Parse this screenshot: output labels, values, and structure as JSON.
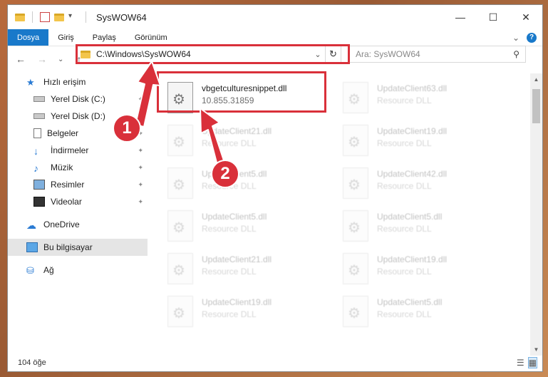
{
  "window": {
    "title": "SysWOW64",
    "controls": {
      "minimize": "—",
      "maximize": "☐",
      "close": "✕"
    }
  },
  "ribbon": {
    "tabs": [
      "Dosya",
      "Giriş",
      "Paylaş",
      "Görünüm"
    ],
    "expand": "⌄",
    "help": "?"
  },
  "nav": {
    "back": "←",
    "forward": "→",
    "recent": "⌄",
    "up": "↑",
    "address": "C:\\Windows\\SysWOW64",
    "address_chevron": "⌄",
    "refresh": "↻",
    "search_placeholder": "Ara: SysWOW64",
    "search_icon": "⚲"
  },
  "sidebar": {
    "items": [
      {
        "label": "Hızlı erişim",
        "icon": "star-icon"
      },
      {
        "label": "Yerel Disk (C:)",
        "icon": "drive-icon",
        "pinned": true
      },
      {
        "label": "Yerel Disk (D:)",
        "icon": "drive-icon",
        "pinned": true
      },
      {
        "label": "Belgeler",
        "icon": "document-icon",
        "pinned": true
      },
      {
        "label": "İndirmeler",
        "icon": "download-icon",
        "pinned": true
      },
      {
        "label": "Müzik",
        "icon": "music-icon",
        "pinned": true
      },
      {
        "label": "Resimler",
        "icon": "pictures-icon",
        "pinned": true
      },
      {
        "label": "Videolar",
        "icon": "videos-icon",
        "pinned": true
      },
      {
        "label": "OneDrive",
        "icon": "cloud-icon"
      },
      {
        "label": "Bu bilgisayar",
        "icon": "computer-icon",
        "selected": true
      },
      {
        "label": "Ağ",
        "icon": "network-icon"
      }
    ],
    "pin_glyph": "📌"
  },
  "files": [
    {
      "name": "vbgetculturesnippet.dll",
      "desc": "10.855.31859",
      "highlight": true
    },
    {
      "name": "UpdateClient63.dll",
      "desc": "Resource DLL"
    },
    {
      "name": "UpdateClient21.dll",
      "desc": "Resource DLL"
    },
    {
      "name": "UpdateClient19.dll",
      "desc": "Resource DLL"
    },
    {
      "name": "UpdateClient5.dll",
      "desc": "Resource DLL"
    },
    {
      "name": "UpdateClient42.dll",
      "desc": "Resource DLL"
    },
    {
      "name": "UpdateClient5.dll",
      "desc": "Resource DLL"
    },
    {
      "name": "UpdateClient5.dll",
      "desc": "Resource DLL"
    },
    {
      "name": "UpdateClient21.dll",
      "desc": "Resource DLL"
    },
    {
      "name": "UpdateClient19.dll",
      "desc": "Resource DLL"
    },
    {
      "name": "UpdateClient19.dll",
      "desc": "Resource DLL"
    },
    {
      "name": "UpdateClient5.dll",
      "desc": "Resource DLL"
    }
  ],
  "status": {
    "count": "104 öğe"
  },
  "callouts": {
    "one": "1",
    "two": "2"
  },
  "colors": {
    "accent": "#1979ca",
    "highlight": "#d9303a"
  }
}
